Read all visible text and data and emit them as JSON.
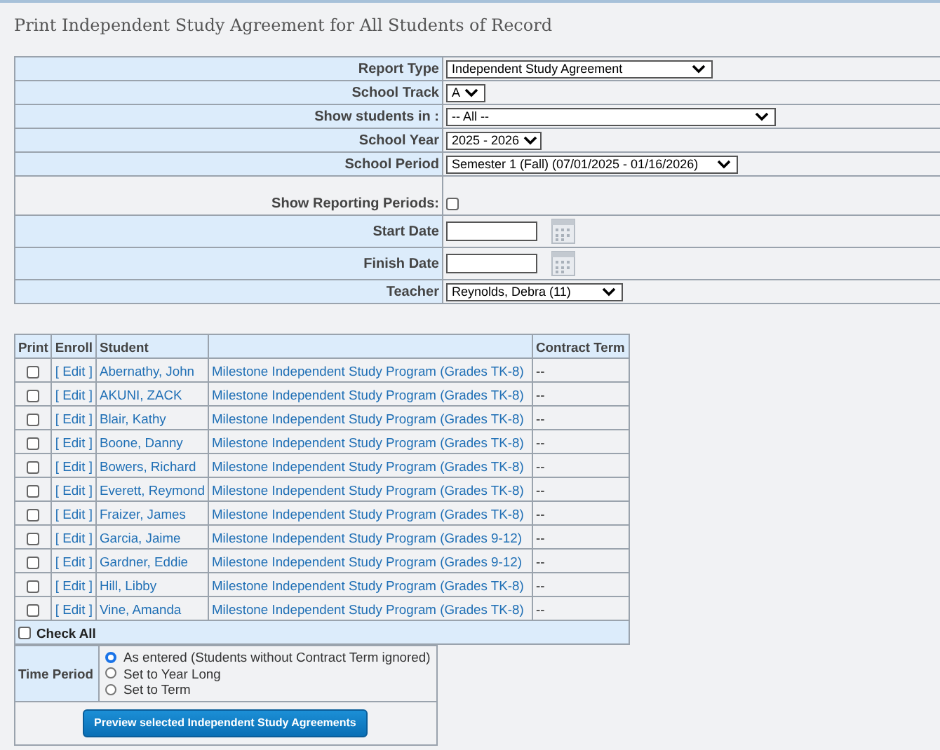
{
  "title": "Print Independent Study Agreement for All Students of Record",
  "form": [
    {
      "label": "Report Type",
      "kind": "select",
      "value": "Independent Study Agreement"
    },
    {
      "label": "School Track",
      "kind": "select",
      "value": "A"
    },
    {
      "label": "Show students in :",
      "kind": "select",
      "value": "-- All --"
    },
    {
      "label": "School Year",
      "kind": "select",
      "value": "2025 - 2026"
    },
    {
      "label": "School Period",
      "kind": "select",
      "value": "Semester 1 (Fall) (07/01/2025 - 01/16/2026)"
    },
    {
      "label": "Show Reporting Periods:",
      "kind": "checkbox",
      "checked": false
    },
    {
      "label": "Start Date",
      "kind": "date"
    },
    {
      "label": "Finish Date",
      "kind": "date"
    },
    {
      "label": "Teacher",
      "kind": "select",
      "value": "Reynolds, Debra (11)"
    }
  ],
  "columns": [
    "Print",
    "Enroll",
    "Student",
    "Contract Term"
  ],
  "students": [
    {
      "checked": false,
      "edit": "[ Edit ]",
      "name": "Abernathy, John",
      "program": "Milestone Independent Study Program (Grades TK-8)",
      "term": "--"
    },
    {
      "checked": false,
      "edit": "[ Edit ]",
      "name": "AKUNI, ZACK",
      "program": "Milestone Independent Study Program (Grades TK-8)",
      "term": "--"
    },
    {
      "checked": false,
      "edit": "[ Edit ]",
      "name": "Blair, Kathy",
      "program": "Milestone Independent Study Program (Grades TK-8)",
      "term": "--"
    },
    {
      "checked": false,
      "edit": "[ Edit ]",
      "name": "Boone, Danny",
      "program": "Milestone Independent Study Program (Grades TK-8)",
      "term": "--"
    },
    {
      "checked": false,
      "edit": "[ Edit ]",
      "name": "Bowers, Richard",
      "program": "Milestone Independent Study Program (Grades TK-8)",
      "term": "--"
    },
    {
      "checked": false,
      "edit": "[ Edit ]",
      "name": "Everett, Reymond",
      "program": "Milestone Independent Study Program (Grades TK-8)",
      "term": "--"
    },
    {
      "checked": false,
      "edit": "[ Edit ]",
      "name": "Fraizer, James",
      "program": "Milestone Independent Study Program (Grades TK-8)",
      "term": "--"
    },
    {
      "checked": false,
      "edit": "[ Edit ]",
      "name": "Garcia, Jaime",
      "program": "Milestone Independent Study Program (Grades 9-12)",
      "term": "--"
    },
    {
      "checked": false,
      "edit": "[ Edit ]",
      "name": "Gardner, Eddie",
      "program": "Milestone Independent Study Program (Grades 9-12)",
      "term": "--"
    },
    {
      "checked": false,
      "edit": "[ Edit ]",
      "name": "Hill, Libby",
      "program": "Milestone Independent Study Program (Grades TK-8)",
      "term": "--"
    },
    {
      "checked": false,
      "edit": "[ Edit ]",
      "name": "Vine, Amanda",
      "program": "Milestone Independent Study Program (Grades TK-8)",
      "term": "--"
    }
  ],
  "check_all": {
    "label": "Check All",
    "checked": false
  },
  "time_period": {
    "label": "Time Period",
    "options": [
      {
        "label": "As entered (Students without Contract Term ignored)",
        "selected": true
      },
      {
        "label": "Set to Year Long",
        "selected": false
      },
      {
        "label": "Set to Term",
        "selected": false
      }
    ]
  },
  "button": "Preview selected Independent Study Agreements"
}
